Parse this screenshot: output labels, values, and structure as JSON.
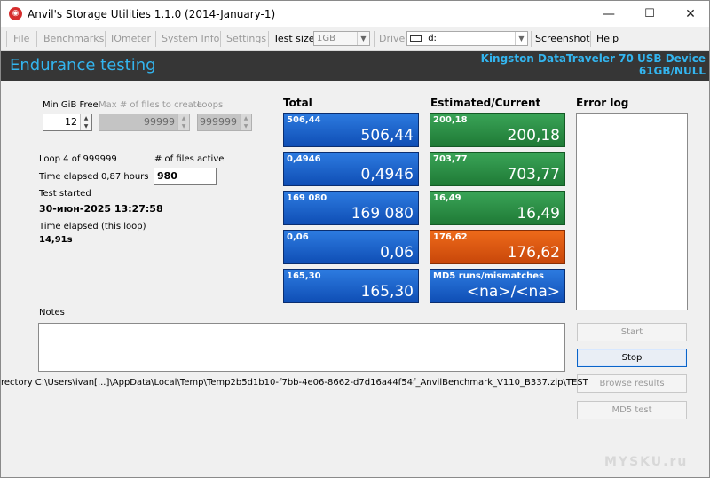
{
  "window": {
    "title": "Anvil's Storage Utilities 1.1.0 (2014-January-1)",
    "minimize": "—",
    "maximize": "☐",
    "close": "✕"
  },
  "menu": {
    "file": "File",
    "benchmarks": "Benchmarks",
    "iometer": "IOmeter",
    "system_info": "System Info",
    "settings": "Settings",
    "test_size_label": "Test size",
    "test_size_value": "1GB",
    "drive_label": "Drive",
    "drive_value": "d:",
    "screenshot": "Screenshot",
    "help": "Help"
  },
  "header": {
    "title": "Endurance testing",
    "device_name": "Kingston DataTraveler 70 USB Device",
    "device_size": "61GB/NULL"
  },
  "params": {
    "min_gib_free_label": "Min GiB Free",
    "min_gib_free_value": "12",
    "max_files_label": "Max # of files to create",
    "max_files_value": "99999",
    "loops_label": "Loops",
    "loops_value": "999999"
  },
  "status": {
    "loop": "Loop 4 of 999999",
    "files_active_label": "# of files active",
    "files_active_value": "980",
    "time_elapsed": "Time elapsed 0,87 hours",
    "test_started_label": "Test started",
    "test_started_value": "30-июн-2025 13:27:58",
    "time_elapsed_loop_label": "Time elapsed (this loop)",
    "time_elapsed_loop_value": "14,91s"
  },
  "columns": {
    "total": "Total",
    "estimated": "Estimated/Current",
    "error_log": "Error log"
  },
  "total_tiles": [
    {
      "small": "506,44",
      "big": "506,44"
    },
    {
      "small": "0,4946",
      "big": "0,4946"
    },
    {
      "small": "169 080",
      "big": "169 080"
    },
    {
      "small": "0,06",
      "big": "0,06"
    },
    {
      "small": "165,30",
      "big": "165,30"
    }
  ],
  "estimated_tiles": [
    {
      "small": "200,18",
      "big": "200,18"
    },
    {
      "small": "703,77",
      "big": "703,77"
    },
    {
      "small": "16,49",
      "big": "16,49"
    },
    {
      "small": "176,62",
      "big": "176,62"
    },
    {
      "small": "MD5 runs/mismatches",
      "big": "<na>/<na>"
    }
  ],
  "notes_label": "Notes",
  "buttons": {
    "start": "Start",
    "stop": "Stop",
    "browse": "Browse results",
    "md5": "MD5 test"
  },
  "status_line": "rectory C:\\Users\\ivan[...]\\AppData\\Local\\Temp\\Temp2b5d1b10-f7bb-4e06-8662-d7d16a44f54f_AnvilBenchmark_V110_B337.zip\\TEST",
  "watermark": "MYSKU.ru"
}
